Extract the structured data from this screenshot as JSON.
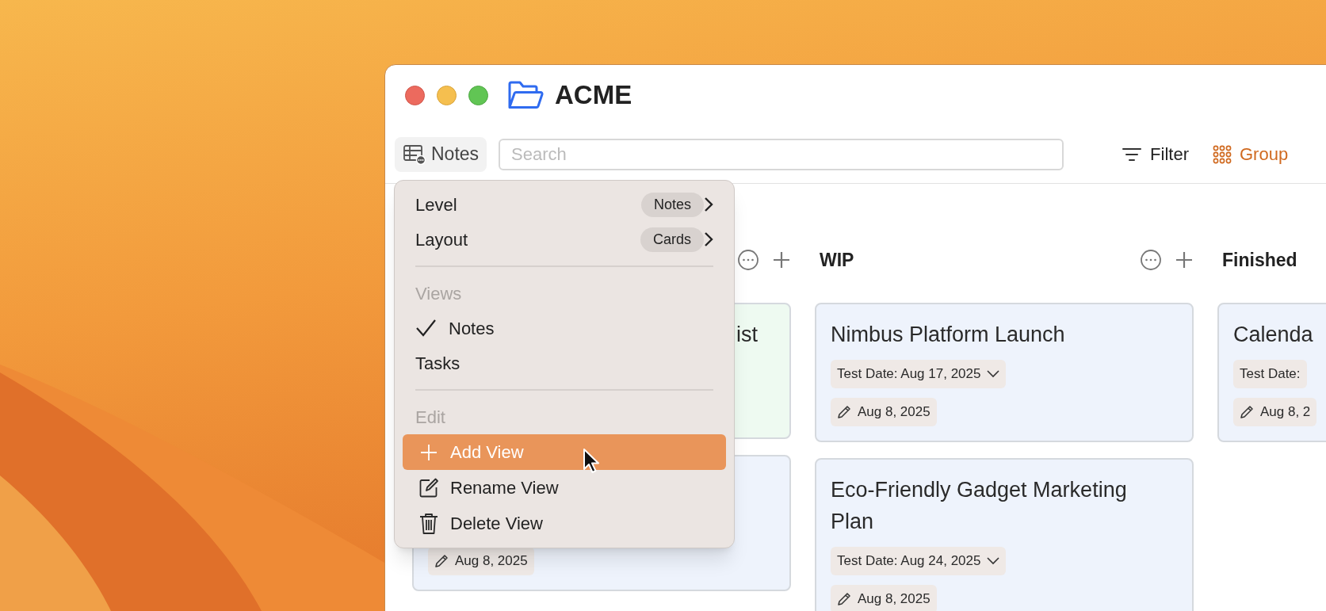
{
  "window": {
    "title": "ACME"
  },
  "toolbar": {
    "view_button": {
      "label": "Notes"
    },
    "search": {
      "placeholder": "Search"
    },
    "actions": [
      {
        "kind": "filter",
        "label": "Filter",
        "active": false
      },
      {
        "kind": "group",
        "label": "Group",
        "active": true
      }
    ]
  },
  "columns": [
    {
      "cards": [
        {
          "title": "ist",
          "color": "#eefaf1"
        },
        {
          "edited": "Aug 8, 2025",
          "color": "#eef3fc"
        }
      ]
    },
    {
      "title": "WIP",
      "cards": [
        {
          "title": "Nimbus Platform Launch",
          "test_date": {
            "text": "Test Date: Aug 17, 2025",
            "dropdown": true
          },
          "edited": "Aug 8, 2025",
          "color": "#eef3fc"
        },
        {
          "title": "Eco-Friendly Gadget Marketing Plan",
          "test_date": {
            "text": "Test Date: Aug 24, 2025",
            "dropdown": true
          },
          "edited": "Aug 8, 2025",
          "color": "#eef3fc"
        }
      ]
    },
    {
      "title": "Finished",
      "cards": [
        {
          "title": "Calenda",
          "test_date": {
            "text": "Test Date:",
            "dropdown": false
          },
          "edited": "Aug 8, 2",
          "color": "#eef3fc"
        }
      ]
    }
  ],
  "menu": {
    "items": [
      {
        "kind": "submenu",
        "label": "Level",
        "value": "Notes"
      },
      {
        "kind": "submenu",
        "label": "Layout",
        "value": "Cards"
      },
      {
        "kind": "divider"
      },
      {
        "kind": "header",
        "label": "Views"
      },
      {
        "kind": "option",
        "label": "Notes",
        "checked": true
      },
      {
        "kind": "option",
        "label": "Tasks",
        "checked": false
      },
      {
        "kind": "divider"
      },
      {
        "kind": "header",
        "label": "Edit"
      },
      {
        "kind": "add",
        "label": "Add View",
        "highlighted": true
      },
      {
        "kind": "rename",
        "label": "Rename View",
        "highlighted": false
      },
      {
        "kind": "delete",
        "label": "Delete View",
        "highlighted": false
      }
    ]
  }
}
